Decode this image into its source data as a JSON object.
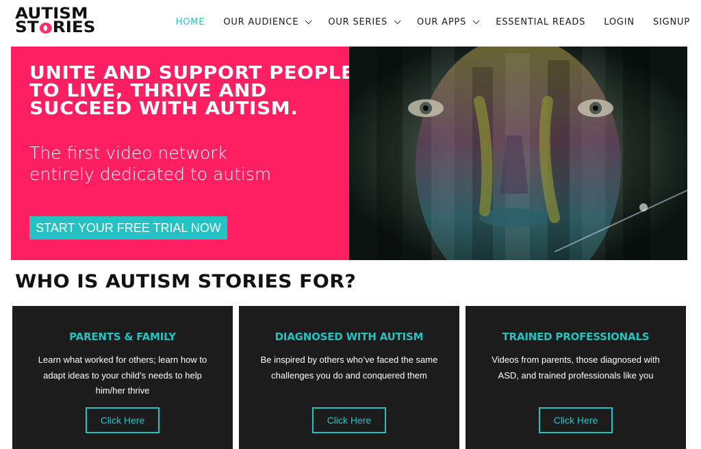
{
  "brand": {
    "logo_line1": "AUTISM",
    "logo_line2_pre": "ST",
    "logo_line2_post": "RIES",
    "accent_color": "#25c2c4",
    "hero_color": "#fe1f63"
  },
  "nav": {
    "items": [
      {
        "label": "HOME",
        "active": true
      },
      {
        "label": "OUR AUDIENCE",
        "dropdown": true
      },
      {
        "label": "OUR SERIES",
        "dropdown": true
      },
      {
        "label": "OUR APPS",
        "dropdown": true
      },
      {
        "label": "ESSENTIAL READS"
      },
      {
        "label": "LOGIN"
      },
      {
        "label": "SIGNUP"
      }
    ]
  },
  "hero": {
    "title": "Unite and support people to live, thrive and succeed with autism.",
    "subtitle": "The first video network entirely dedicated to autism",
    "cta_label": "START YOUR FREE TRIAL NOW"
  },
  "section": {
    "title": "WHO IS AUTISM STORIES FOR?"
  },
  "cards": [
    {
      "title": "PARENTS & FAMILY",
      "text": "Learn what worked for others; learn how to adapt ideas to your child’s needs to help him/her thrive",
      "button": "Click Here"
    },
    {
      "title": "DIAGNOSED WITH AUTISM",
      "text": "Be inspired by others who’ve faced the same challenges you do and conquered them",
      "button": "Click Here"
    },
    {
      "title": "TRAINED PROFESSIONALS",
      "text": "Videos from parents, those diagnosed with ASD, and trained professionals like you",
      "button": "Click Here"
    }
  ]
}
